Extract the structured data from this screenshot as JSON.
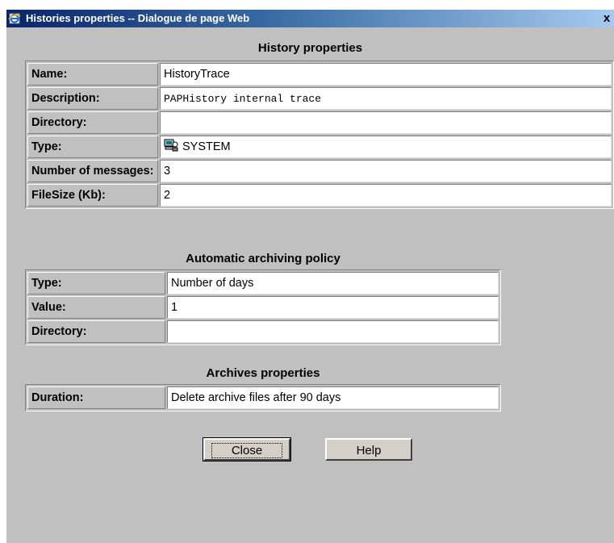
{
  "window": {
    "title": "Histories properties -- Dialogue de page Web",
    "close_glyph": "x",
    "icon": "ie-page-icon"
  },
  "history": {
    "title": "History properties",
    "rows": [
      {
        "label": "Name:",
        "value": "HistoryTrace"
      },
      {
        "label": "Description:",
        "value": "PAPHistory internal trace"
      },
      {
        "label": "Directory:",
        "value": ""
      },
      {
        "label": "Type:",
        "value": "SYSTEM",
        "icon": "system-icon"
      },
      {
        "label": "Number of messages:",
        "value": "3"
      },
      {
        "label": "FileSize (Kb):",
        "value": "2"
      }
    ]
  },
  "archiving": {
    "title": "Automatic archiving policy",
    "rows": [
      {
        "label": "Type:",
        "value": "Number of days"
      },
      {
        "label": "Value:",
        "value": "1"
      },
      {
        "label": "Directory:",
        "value": ""
      }
    ]
  },
  "archives": {
    "title": "Archives properties",
    "rows": [
      {
        "label": "Duration:",
        "value": "Delete archive files after 90 days"
      }
    ]
  },
  "buttons": {
    "close_label": "Close",
    "help_label": "Help"
  }
}
